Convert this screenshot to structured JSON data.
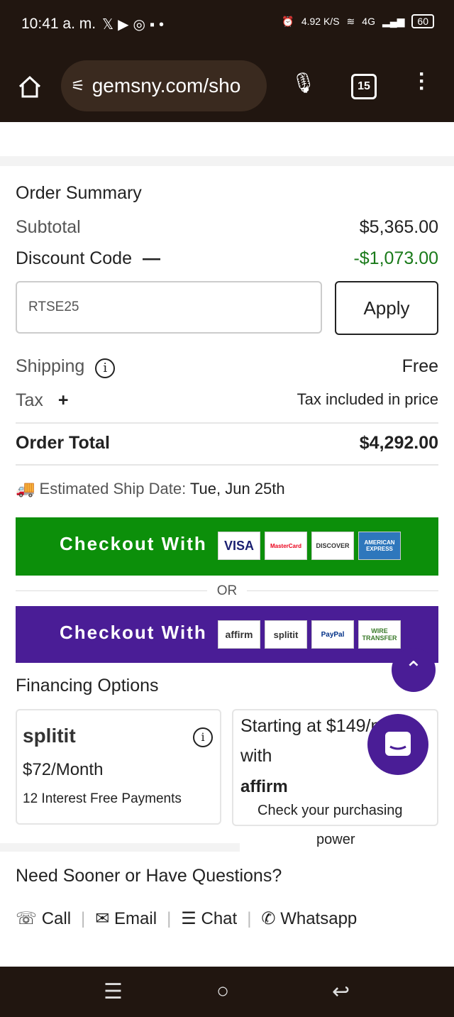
{
  "status": {
    "time": "10:41 a. m.",
    "speed_value": "4.92",
    "speed_unit": "K/S",
    "network": "4G",
    "battery": "60"
  },
  "browser": {
    "url": "gemsny.com/sho",
    "tab_count": "15"
  },
  "order": {
    "title": "Order Summary",
    "subtotal_label": "Subtotal",
    "subtotal": "$5,365.00",
    "discount_label": "Discount Code",
    "discount_toggle": "—",
    "discount": "-$1,073.00",
    "code_value": "RTSE25",
    "apply_label": "Apply",
    "shipping_label": "Shipping",
    "shipping_info": "i",
    "shipping": "Free",
    "tax_label": "Tax",
    "tax_toggle": "+",
    "tax": "Tax included in price",
    "total_label": "Order Total",
    "total": "$4,292.00",
    "ship_date_label": "Estimated Ship Date:",
    "ship_date": "Tue, Jun 25th"
  },
  "checkout": {
    "card_button_label": "Checkout With",
    "cards": [
      "VISA",
      "MasterCard",
      "DISCOVER",
      "AMERICAN EXPRESS"
    ],
    "or_label": "OR",
    "alt_button_label": "Checkout With",
    "alt_methods": [
      "affirm",
      "splitit",
      "PayPal",
      "WIRE TRANSFER"
    ]
  },
  "financing": {
    "title": "Financing Options",
    "splitit_logo": "splitit",
    "splitit_price": "$72/Month",
    "splitit_desc": "12 Interest Free Payments",
    "affirm_line1": "Starting at $149/mo",
    "affirm_line2": "with",
    "affirm_logo": "affirm",
    "affirm_desc": "Check your purchasing",
    "affirm_desc2": "power"
  },
  "help": {
    "title": "Need Sooner or Have Questions?",
    "links": [
      "Call",
      "Email",
      "Chat",
      "Whatsapp"
    ]
  },
  "colors": {
    "green": "#0c8f0a",
    "purple": "#4a1d96",
    "dark": "#211610"
  }
}
